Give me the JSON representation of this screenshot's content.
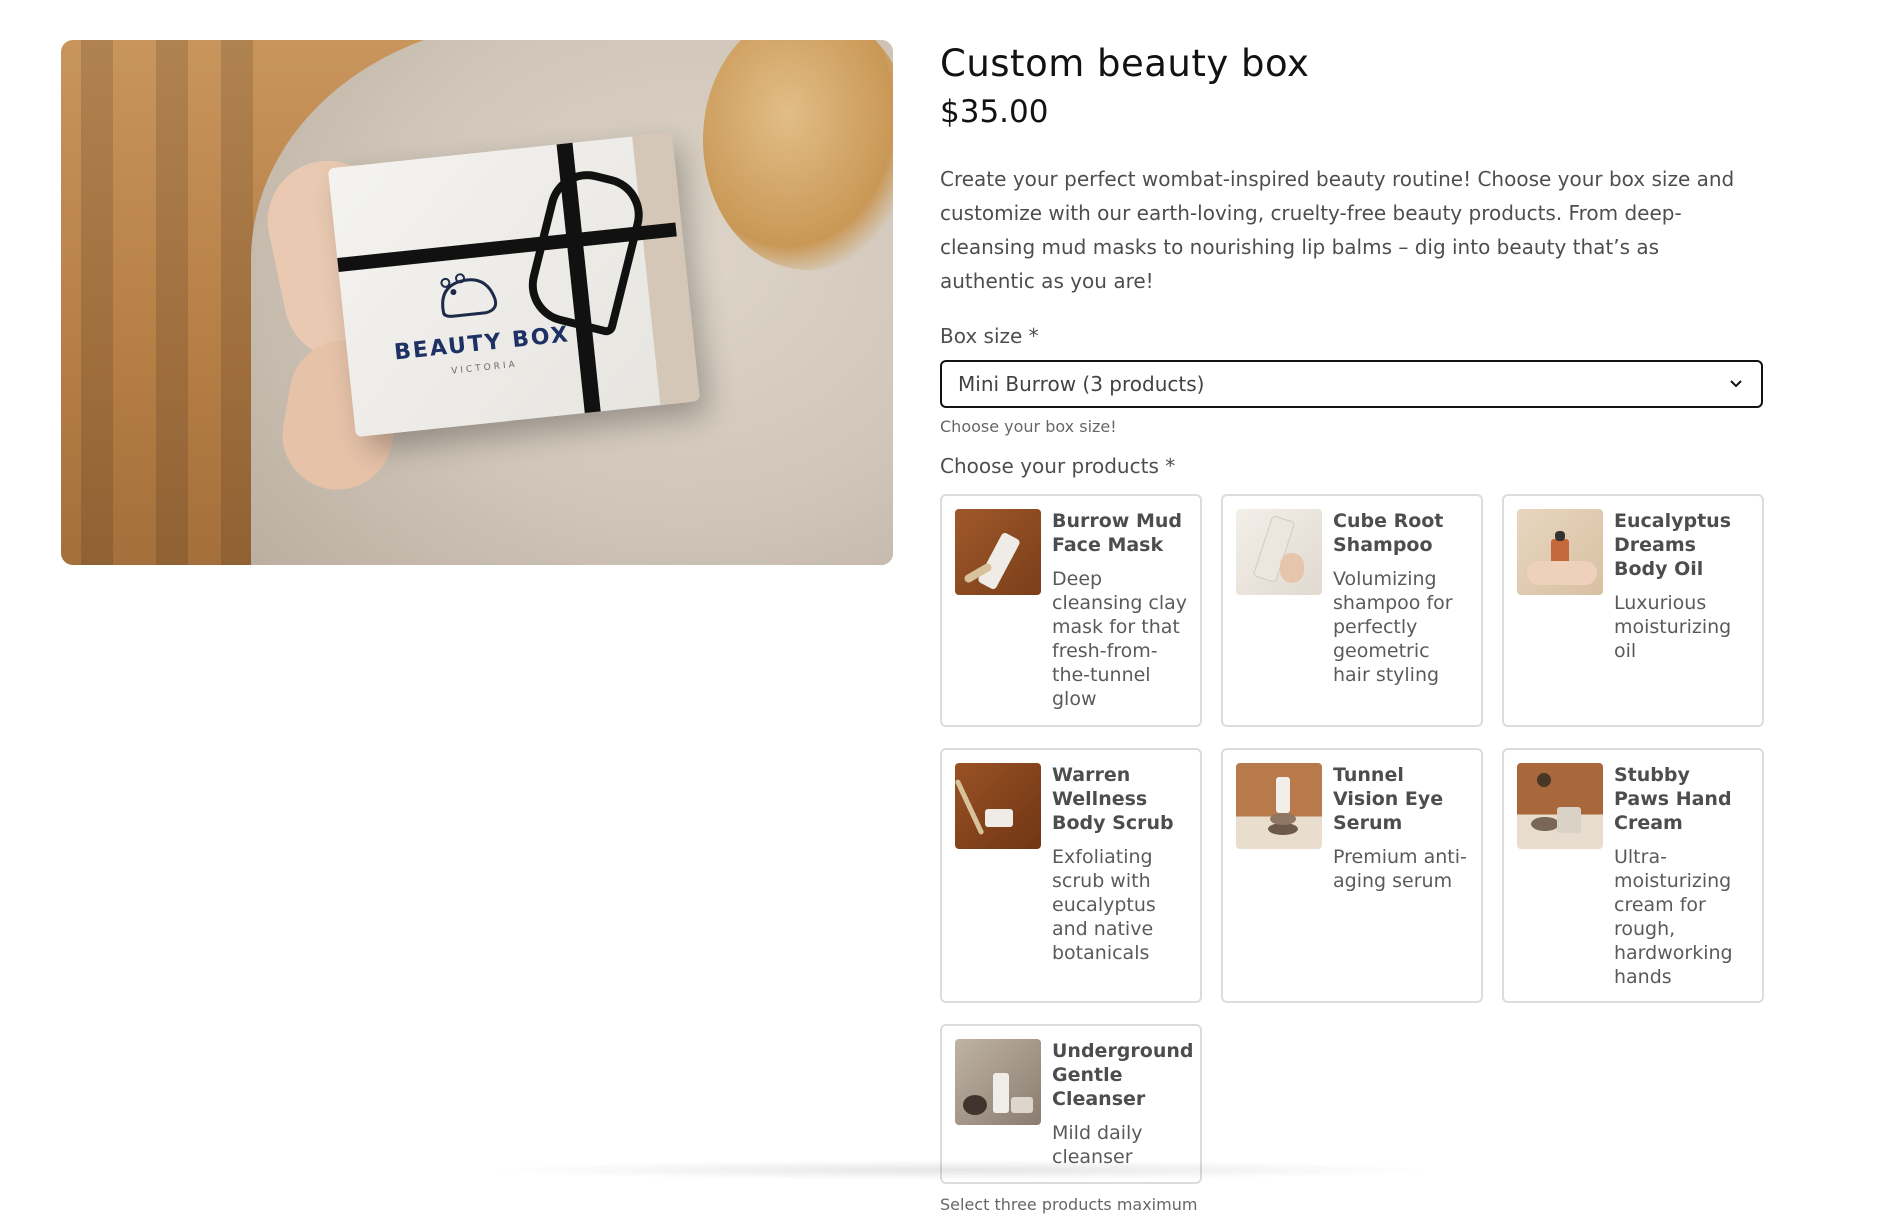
{
  "product": {
    "title": "Custom beauty box",
    "price": "$35.00",
    "description": "Create your perfect wombat-inspired beauty routine! Choose your box size and customize with our earth-loving, cruelty-free beauty products. From deep-cleansing mud masks to nourishing lip balms – dig into beauty that’s as authentic as you are!",
    "image": {
      "logo_title": "BEAUTY BOX",
      "logo_sub": "VICTORIA"
    }
  },
  "box_size": {
    "label": "Box size *",
    "selected": "Mini Burrow (3 products)",
    "help": "Choose your box size!"
  },
  "products_field": {
    "label": "Choose your products *",
    "help": "Select three products maximum",
    "items": [
      {
        "title": "Burrow Mud Face Mask",
        "desc": "Deep cleansing clay mask for that fresh-from-the-tunnel glow"
      },
      {
        "title": "Cube Root Shampoo",
        "desc": "Volumizing shampoo for perfectly geometric hair styling"
      },
      {
        "title": "Eucalyptus Dreams Body Oil",
        "desc": "Luxurious moisturizing oil"
      },
      {
        "title": "Warren Wellness Body Scrub",
        "desc": "Exfoliating scrub with eucalyptus and native botanicals"
      },
      {
        "title": "Tunnel Vision Eye Serum",
        "desc": "Premium anti-aging serum"
      },
      {
        "title": "Stubby Paws Hand Cream",
        "desc": "Ultra-moisturizing cream for rough, hardworking hands"
      },
      {
        "title": "Underground Gentle Cleanser",
        "desc": "Mild daily cleanser"
      }
    ]
  },
  "icons": {
    "chevron": "chevron-down-icon"
  },
  "colors": {
    "text": "#121212",
    "border": "#dcdcdc"
  }
}
